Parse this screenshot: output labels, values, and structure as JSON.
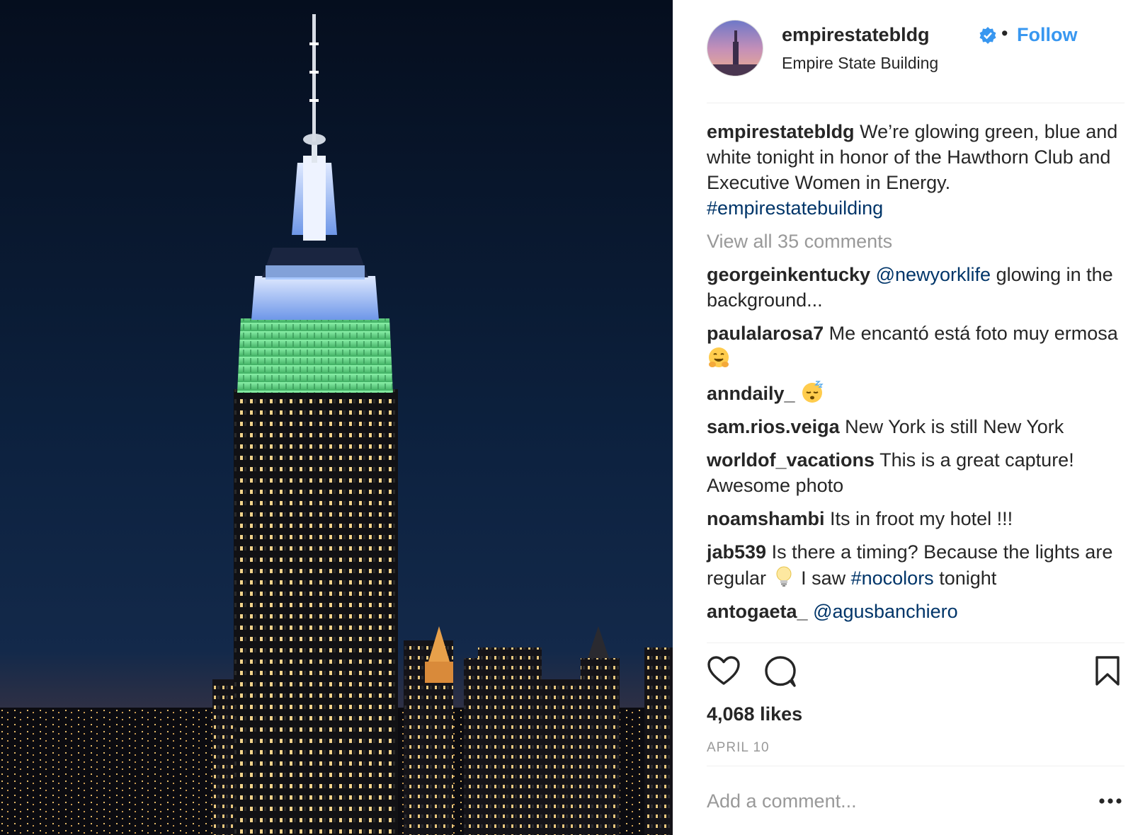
{
  "post": {
    "username": "empirestatebldg",
    "follow_label": "Follow",
    "location": "Empire State Building",
    "caption_user": "empirestatebldg",
    "caption_text": "We’re glowing green, blue and white tonight in honor of the Hawthorn Club and Executive Women in Energy.",
    "caption_hashtag": "#empirestatebuilding",
    "view_all": "View all 35 comments",
    "likes": "4,068 likes",
    "date": "APRIL 10",
    "add_comment_placeholder": "Add a comment...",
    "more_label": "..."
  },
  "comments": [
    {
      "user": "georgeinkentucky",
      "mention": "@newyorklife",
      "text": " glowing in the background..."
    },
    {
      "user": "paulalarosa7",
      "text": " Me encantó está foto muy ermosa",
      "emoji": "hugging-face-emoji"
    },
    {
      "user": "anndaily_",
      "emoji": "sleeping-face-emoji"
    },
    {
      "user": "sam.rios.veiga",
      "text": " New York is still New York"
    },
    {
      "user": "worldof_vacations",
      "text": " This is a great capture! Awesome photo"
    },
    {
      "user": "noamshambi",
      "text": " Its in froot my hotel !!!"
    },
    {
      "user": "jab539",
      "text": " Is there a timing? Because the lights are regular",
      "emoji": "light-bulb-emoji",
      "text2": " I saw ",
      "hashtag": "#nocolors",
      "text3": " tonight"
    },
    {
      "user": "antogaeta_",
      "mention": "@agusbanchiero"
    }
  ],
  "icons": {
    "like": "heart-icon",
    "comment": "comment-bubble-icon",
    "save": "bookmark-icon",
    "verified": "verified-badge-icon"
  },
  "colors": {
    "link_blue": "#3897f0",
    "mention_navy": "#003569",
    "muted_gray": "#999999",
    "text_dark": "#262626",
    "building_green": "#5fd88a",
    "building_blue": "#8fb4f5",
    "sky_night": "#0a1a33"
  }
}
